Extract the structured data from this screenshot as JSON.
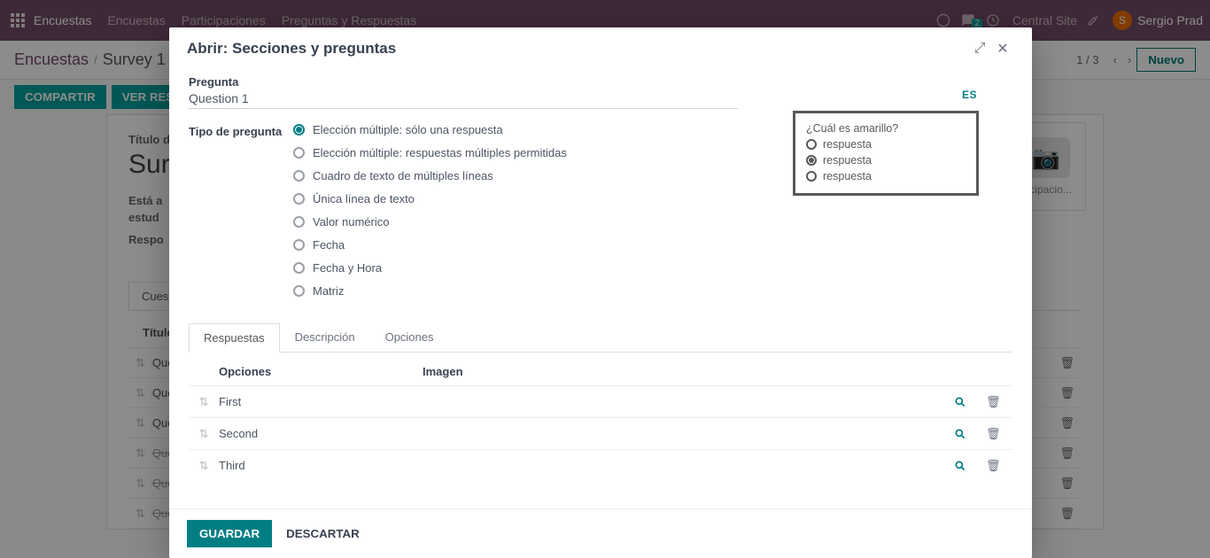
{
  "nav": {
    "brand": "Encuestas",
    "links": [
      "Encuestas",
      "Participaciones",
      "Preguntas y Respuestas"
    ],
    "msg_badge": "2",
    "site": "Central Site",
    "user_initial": "S",
    "user_name": "Sergio Prad"
  },
  "breadcrumb": {
    "root": "Encuestas",
    "current": "Survey 1"
  },
  "pager": {
    "text": "1 / 3"
  },
  "new_label": "Nuevo",
  "actions": {
    "share": "COMPARTIR",
    "results": "VER RESUL"
  },
  "bgform": {
    "title_label": "Título de",
    "title_value": "Sur",
    "intro1": "Está a",
    "intro2": "estud",
    "resp_label": "Respo",
    "tab": "Cuesti",
    "col_title": "Título",
    "stat_label": "rticipacio...",
    "rows": [
      "Questi",
      "Questi",
      "Questi",
      "Questi",
      "Questi",
      "Questi"
    ]
  },
  "modal": {
    "title": "Abrir: Secciones y preguntas",
    "q_label": "Pregunta",
    "q_value": "Question 1",
    "lang": "ES",
    "type_label": "Tipo de pregunta",
    "types": [
      "Elección múltiple: sólo una respuesta",
      "Elección múltiple: respuestas múltiples permitidas",
      "Cuadro de texto de múltiples líneas",
      "Única línea de texto",
      "Valor numérico",
      "Fecha",
      "Fecha y Hora",
      "Matriz"
    ],
    "type_selected": 0,
    "preview": {
      "question": "¿Cuál es amarillo?",
      "answers": [
        "respuesta",
        "respuesta",
        "respuesta"
      ],
      "selected": 1
    },
    "tabs": [
      "Respuestas",
      "Descripción",
      "Opciones"
    ],
    "ans_hdr_options": "Opciones",
    "ans_hdr_image": "Imagen",
    "answers": [
      "First",
      "Second",
      "Third"
    ],
    "save": "GUARDAR",
    "discard": "DESCARTAR"
  }
}
